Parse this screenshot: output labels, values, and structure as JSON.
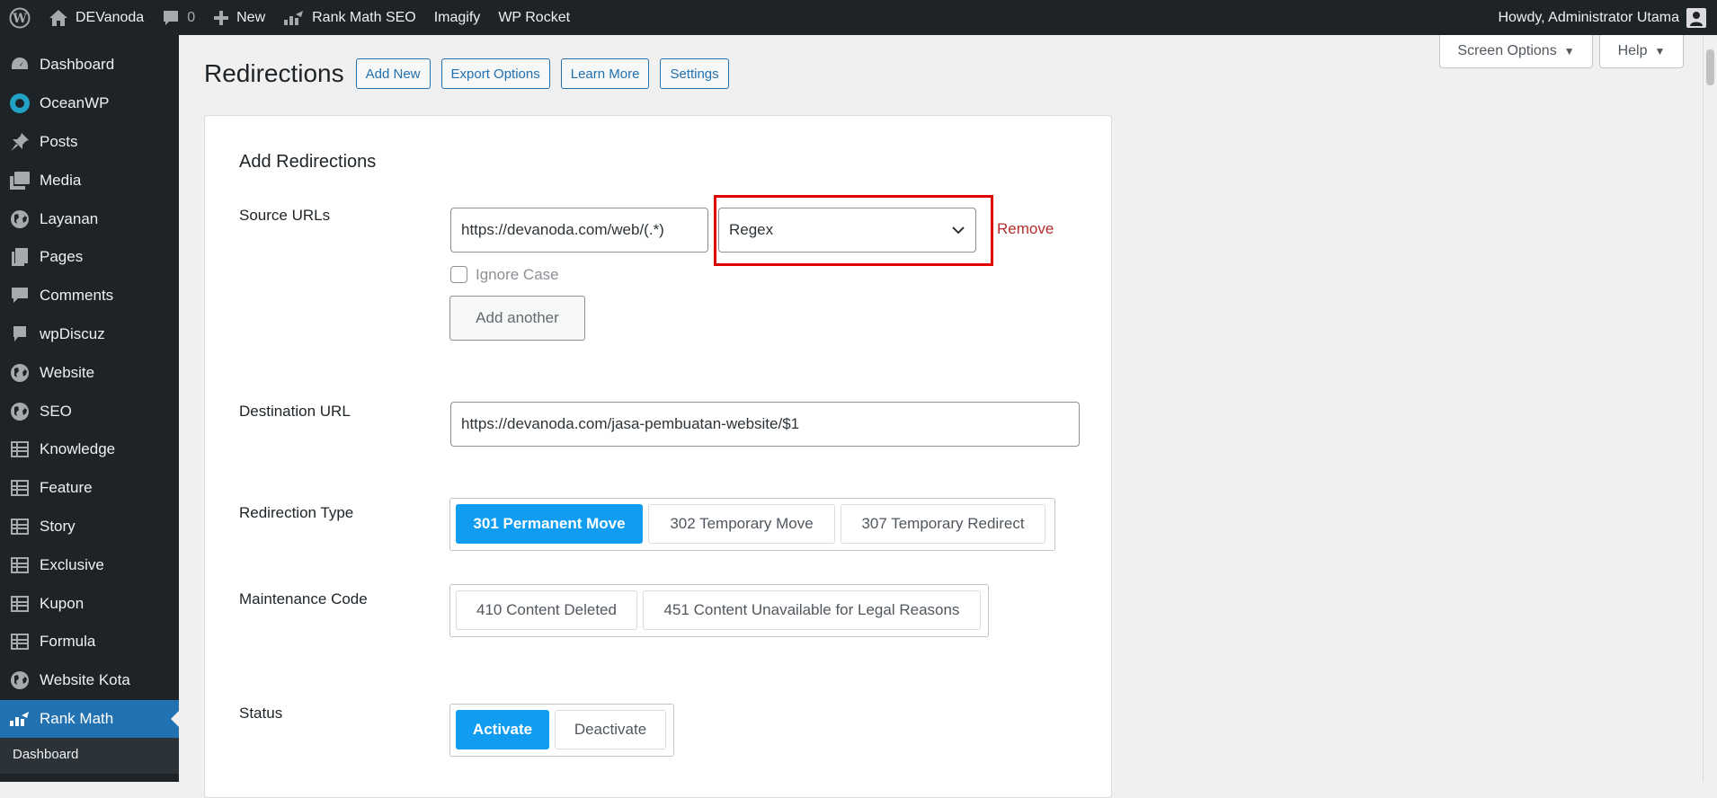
{
  "adminbar": {
    "site_name": "DEVanoda",
    "comment_count": "0",
    "new_label": "New",
    "rank_math_label": "Rank Math SEO",
    "imagify_label": "Imagify",
    "wp_rocket_label": "WP Rocket",
    "howdy_label": "Howdy, Administrator Utama"
  },
  "sidebar": {
    "items": [
      {
        "label": "Dashboard",
        "icon": "dashboard-icon"
      },
      {
        "label": "OceanWP",
        "icon": "oceanwp-icon"
      },
      {
        "label": "Posts",
        "icon": "pin-icon"
      },
      {
        "label": "Media",
        "icon": "media-icon"
      },
      {
        "label": "Layanan",
        "icon": "globe-icon"
      },
      {
        "label": "Pages",
        "icon": "pages-icon"
      },
      {
        "label": "Comments",
        "icon": "comment-icon"
      },
      {
        "label": "wpDiscuz",
        "icon": "comment-icon"
      },
      {
        "label": "Website",
        "icon": "globe-icon"
      },
      {
        "label": "SEO",
        "icon": "globe-icon"
      },
      {
        "label": "Knowledge",
        "icon": "grid-icon"
      },
      {
        "label": "Feature",
        "icon": "grid-icon"
      },
      {
        "label": "Story",
        "icon": "grid-icon"
      },
      {
        "label": "Exclusive",
        "icon": "grid-icon"
      },
      {
        "label": "Kupon",
        "icon": "grid-icon"
      },
      {
        "label": "Formula",
        "icon": "grid-icon"
      },
      {
        "label": "Website Kota",
        "icon": "globe-icon"
      },
      {
        "label": "Rank Math",
        "icon": "rank-math-icon"
      }
    ],
    "submenu_first": "Dashboard"
  },
  "header": {
    "title": "Redirections",
    "buttons": [
      "Add New",
      "Export Options",
      "Learn More",
      "Settings"
    ],
    "screen_options": "Screen Options",
    "help": "Help"
  },
  "form": {
    "card_title": "Add Redirections",
    "source_label": "Source URLs",
    "source_value": "https://devanoda.com/web/(.*)",
    "match_type": "Regex",
    "remove_label": "Remove",
    "ignore_case_label": "Ignore Case",
    "add_another_label": "Add another",
    "destination_label": "Destination URL",
    "destination_value": "https://devanoda.com/jasa-pembuatan-website/$1",
    "redirection_type_label": "Redirection Type",
    "redirection_types": [
      "301 Permanent Move",
      "302 Temporary Move",
      "307 Temporary Redirect"
    ],
    "maintenance_label": "Maintenance Code",
    "maintenance_codes": [
      "410 Content Deleted",
      "451 Content Unavailable for Legal Reasons"
    ],
    "status_label": "Status",
    "status_options": [
      "Activate",
      "Deactivate"
    ]
  },
  "colors": {
    "accent": "#2271b1",
    "selected": "#109cf1",
    "highlight": "#e00000",
    "remove": "#b32d2e"
  }
}
